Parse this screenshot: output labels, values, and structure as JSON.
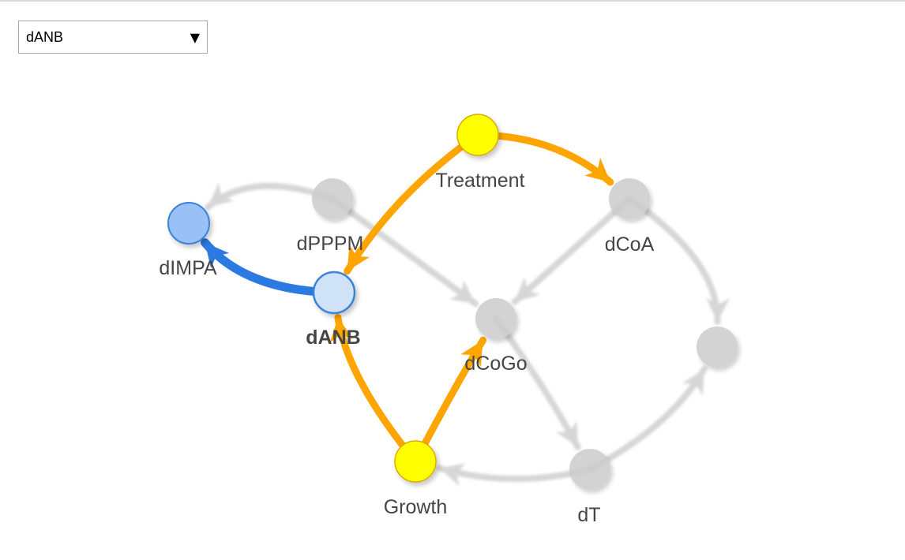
{
  "selector": {
    "value": "dANB"
  },
  "colors": {
    "inactive": "#cccccc",
    "highlight": "#ffa500",
    "selected_edge": "#2a7ae2",
    "exposure_fill": "#ffff00",
    "exposure_stroke": "#ddaa00",
    "selected_fill": "#d0e2f7",
    "outcome_fill": "#99c0f7",
    "node_stroke_blue": "#3b83d9"
  },
  "nodes": [
    {
      "id": "Treatment",
      "label": "Treatment",
      "role": "exposure"
    },
    {
      "id": "dCoA",
      "label": "dCoA",
      "role": "inactive"
    },
    {
      "id": "dPPPM",
      "label": "dPPPM",
      "role": "inactive"
    },
    {
      "id": "dIMPA",
      "label": "dIMPA",
      "role": "outcome"
    },
    {
      "id": "dANB",
      "label": "dANB",
      "role": "selected"
    },
    {
      "id": "dCoGo",
      "label": "dCoGo",
      "role": "inactive"
    },
    {
      "id": "Growth",
      "label": "Growth",
      "role": "exposure"
    },
    {
      "id": "dT",
      "label": "dT",
      "role": "inactive"
    },
    {
      "id": "unlabeled",
      "label": "",
      "role": "inactive"
    }
  ],
  "edges": [
    {
      "from": "Treatment",
      "to": "dCoA",
      "status": "highlight"
    },
    {
      "from": "Treatment",
      "to": "dANB",
      "status": "highlight"
    },
    {
      "from": "Growth",
      "to": "dANB",
      "status": "highlight"
    },
    {
      "from": "Growth",
      "to": "dCoGo",
      "status": "highlight"
    },
    {
      "from": "dANB",
      "to": "dIMPA",
      "status": "selected"
    },
    {
      "from": "dPPPM",
      "to": "dIMPA",
      "status": "inactive"
    },
    {
      "from": "dPPPM",
      "to": "dCoGo",
      "status": "inactive"
    },
    {
      "from": "dCoA",
      "to": "dCoGo",
      "status": "inactive"
    },
    {
      "from": "dCoA",
      "to": "unlabeled",
      "status": "inactive"
    },
    {
      "from": "dT",
      "to": "unlabeled",
      "status": "inactive"
    },
    {
      "from": "dT",
      "to": "Growth",
      "status": "inactive"
    },
    {
      "from": "dCoGo",
      "to": "dT",
      "status": "inactive"
    }
  ]
}
